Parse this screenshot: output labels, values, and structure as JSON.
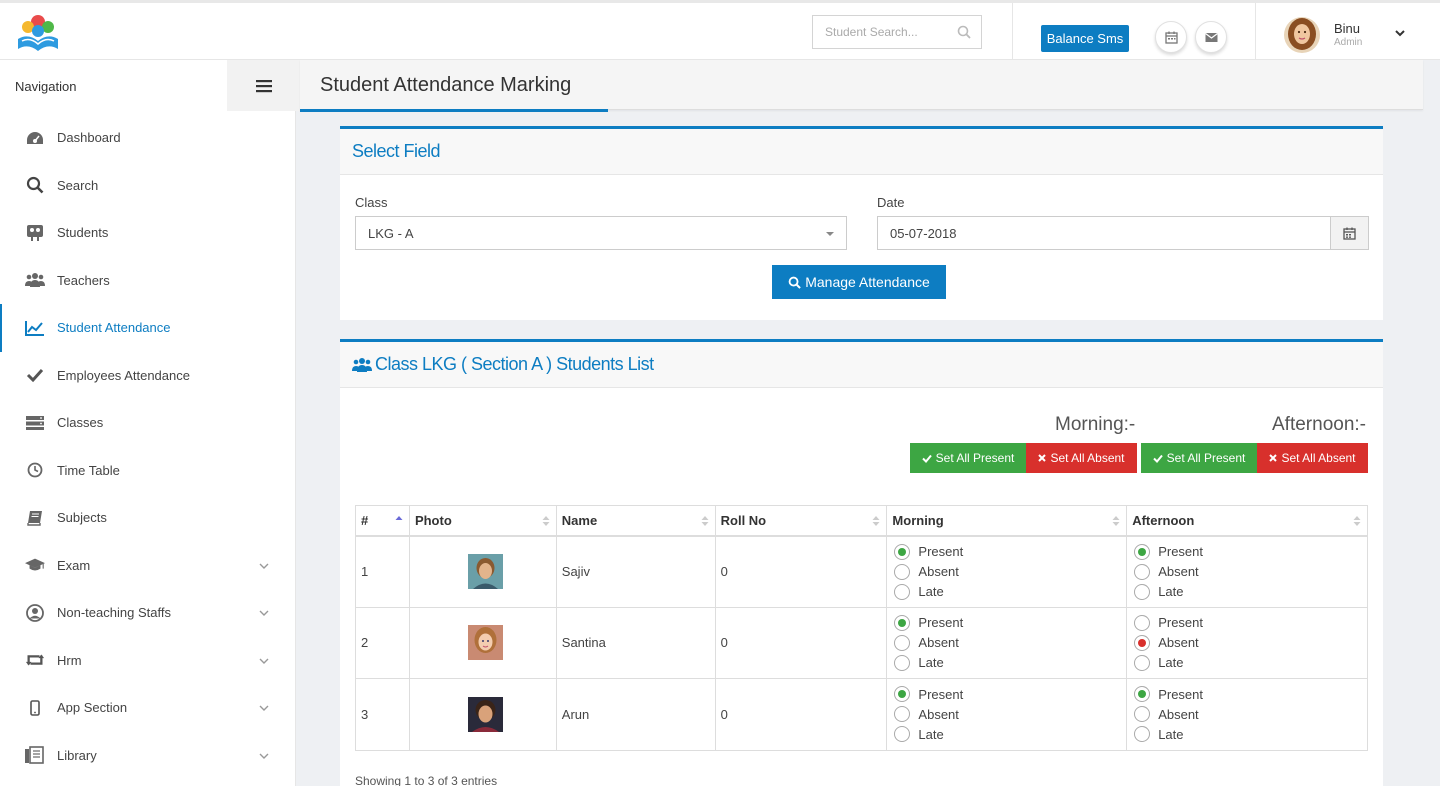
{
  "header": {
    "search_placeholder": "Student Search...",
    "balance_label": "Balance Sms",
    "user_name": "Binu",
    "user_role": "Admin"
  },
  "sidebar": {
    "title": "Navigation",
    "items": [
      {
        "label": "Dashboard",
        "icon": "dashboard-icon"
      },
      {
        "label": "Search",
        "icon": "search-icon"
      },
      {
        "label": "Students",
        "icon": "students-icon"
      },
      {
        "label": "Teachers",
        "icon": "teachers-icon"
      },
      {
        "label": "Student Attendance",
        "icon": "chart-line-icon"
      },
      {
        "label": "Employees Attendance",
        "icon": "check-icon"
      },
      {
        "label": "Classes",
        "icon": "classes-icon"
      },
      {
        "label": "Time Table",
        "icon": "clock-icon"
      },
      {
        "label": "Subjects",
        "icon": "book-icon"
      },
      {
        "label": "Exam",
        "icon": "graduation-cap-icon"
      },
      {
        "label": "Non-teaching Staffs",
        "icon": "user-circle-icon"
      },
      {
        "label": "Hrm",
        "icon": "retweet-icon"
      },
      {
        "label": "App Section",
        "icon": "mobile-icon"
      },
      {
        "label": "Library",
        "icon": "library-icon"
      }
    ]
  },
  "page": {
    "title": "Student Attendance Marking"
  },
  "select_field": {
    "title": "Select Field",
    "class_label": "Class",
    "class_value": "LKG - A",
    "date_label": "Date",
    "date_value": "05-07-2018",
    "manage_label": "Manage Attendance"
  },
  "students_list": {
    "title": "Class LKG ( Section A ) Students List",
    "morning_label": "Morning:-",
    "afternoon_label": "Afternoon:-",
    "set_present_label": "Set All Present",
    "set_absent_label": "Set All Absent",
    "columns": [
      "#",
      "Photo",
      "Name",
      "Roll No",
      "Morning",
      "Afternoon"
    ],
    "options": [
      "Present",
      "Absent",
      "Late"
    ],
    "rows": [
      {
        "num": "1",
        "name": "Sajiv",
        "roll": "0",
        "morning": "Present",
        "afternoon": "Present"
      },
      {
        "num": "2",
        "name": "Santina",
        "roll": "0",
        "morning": "Present",
        "afternoon": "Absent"
      },
      {
        "num": "3",
        "name": "Arun",
        "roll": "0",
        "morning": "Present",
        "afternoon": "Present"
      }
    ],
    "showing": "Showing 1 to 3 of 3 entries"
  },
  "colors": {
    "accent": "#0d7dc2",
    "present": "#3da643",
    "absent": "#d8302c"
  }
}
